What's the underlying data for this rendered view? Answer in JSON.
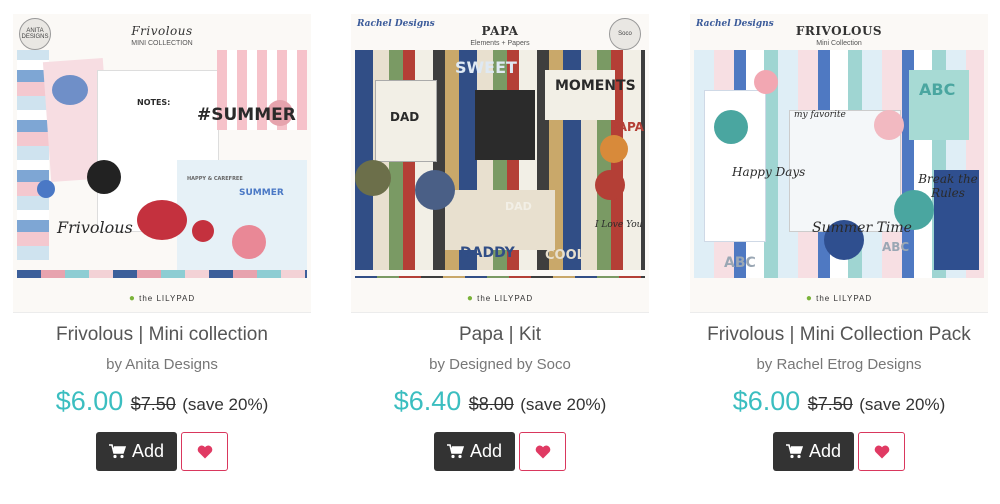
{
  "products": [
    {
      "name": "Frivolous | Mini collection",
      "designer": "by Anita Designs",
      "price": "$6.00",
      "old_price": "$7.50",
      "save": "(save 20%)",
      "add_label": "Add",
      "thumbnail": {
        "title": "Frivolous",
        "subtitle": "MINI COLLECTION",
        "logo": "ANITA DESIGNS",
        "words": [
          "#SUMMER",
          "Frivolous",
          "NOTES:",
          "SUMMER",
          "HAPPY & CAREFREE"
        ],
        "footer": "the LILYPAD"
      }
    },
    {
      "name": "Papa | Kit",
      "designer": "by Designed by Soco",
      "price": "$6.40",
      "old_price": "$8.00",
      "save": "(save 20%)",
      "add_label": "Add",
      "thumbnail": {
        "title": "PAPA",
        "subtitle": "Elements + Papers",
        "logo": "Rachel Designs",
        "seal": "Soco",
        "words": [
          "SWEET",
          "MOMENTS",
          "DAD",
          "DAD",
          "DADDY",
          "COOL",
          "PAPA",
          "I Love You"
        ],
        "footer": "the LILYPAD"
      }
    },
    {
      "name": "Frivolous | Mini Collection Pack",
      "designer": "by Rachel Etrog Designs",
      "price": "$6.00",
      "old_price": "$7.50",
      "save": "(save 20%)",
      "add_label": "Add",
      "thumbnail": {
        "title": "FRIVOLOUS",
        "subtitle": "Mini Collection",
        "logo": "Rachel Designs",
        "words": [
          "ABC",
          "my favorite",
          "Happy Days",
          "Break the Rules",
          "Summer Time",
          "ABC",
          "ABC"
        ],
        "footer": "the LILYPAD"
      }
    }
  ],
  "colors": {
    "price": "#3bbec0",
    "button_dark": "#333333",
    "heart": "#e03a63"
  }
}
